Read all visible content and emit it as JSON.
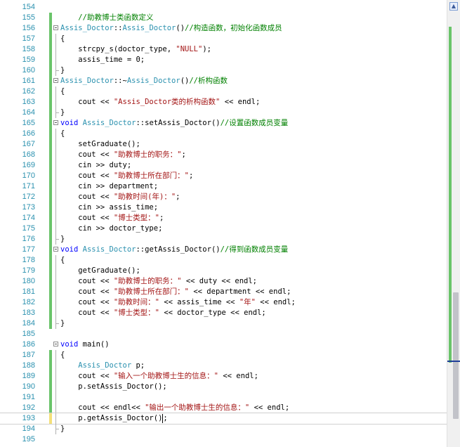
{
  "editor": {
    "lines": [
      {
        "n": "154",
        "t": ""
      },
      {
        "n": "155",
        "t": "    //助教博士类函数定义"
      },
      {
        "n": "156",
        "t": "Assis_Doctor::Assis_Doctor()//构造函数，初始化函数成员"
      },
      {
        "n": "157",
        "t": "{"
      },
      {
        "n": "158",
        "t": "    strcpy_s(doctor_type, \"NULL\");"
      },
      {
        "n": "159",
        "t": "    assis_time = 0;"
      },
      {
        "n": "160",
        "t": "}"
      },
      {
        "n": "161",
        "t": "Assis_Doctor::~Assis_Doctor()//析构函数"
      },
      {
        "n": "162",
        "t": "{"
      },
      {
        "n": "163",
        "t": "    cout << \"Assis_Doctor类的析构函数\" << endl;"
      },
      {
        "n": "164",
        "t": "}"
      },
      {
        "n": "165",
        "t": "void Assis_Doctor::setAssis_Doctor()//设置函数成员变量"
      },
      {
        "n": "166",
        "t": "{"
      },
      {
        "n": "167",
        "t": "    setGraduate();"
      },
      {
        "n": "168",
        "t": "    cout << \"助教博士的职务：\";"
      },
      {
        "n": "169",
        "t": "    cin >> duty;"
      },
      {
        "n": "170",
        "t": "    cout << \"助教博士所在部门：\";"
      },
      {
        "n": "171",
        "t": "    cin >> department;"
      },
      {
        "n": "172",
        "t": "    cout << \"助教时间(年)：\";"
      },
      {
        "n": "173",
        "t": "    cin >> assis_time;"
      },
      {
        "n": "174",
        "t": "    cout << \"博士类型：\";"
      },
      {
        "n": "175",
        "t": "    cin >> doctor_type;"
      },
      {
        "n": "176",
        "t": "}"
      },
      {
        "n": "177",
        "t": "void Assis_Doctor::getAssis_Doctor()//得到函数成员变量"
      },
      {
        "n": "178",
        "t": "{"
      },
      {
        "n": "179",
        "t": "    getGraduate();"
      },
      {
        "n": "180",
        "t": "    cout << \"助教博士的职务：\" << duty << endl;"
      },
      {
        "n": "181",
        "t": "    cout << \"助教博士所在部门：\" << department << endl;"
      },
      {
        "n": "182",
        "t": "    cout << \"助教时间：\" << assis_time << \"年\" << endl;"
      },
      {
        "n": "183",
        "t": "    cout << \"博士类型：\" << doctor_type << endl;"
      },
      {
        "n": "184",
        "t": "}"
      },
      {
        "n": "185",
        "t": ""
      },
      {
        "n": "186",
        "t": "void main()"
      },
      {
        "n": "187",
        "t": "{"
      },
      {
        "n": "188",
        "t": "    Assis_Doctor p;"
      },
      {
        "n": "189",
        "t": "    cout << \"输入一个助教博士生的信息：\" << endl;"
      },
      {
        "n": "190",
        "t": "    p.setAssis_Doctor();"
      },
      {
        "n": "191",
        "t": ""
      },
      {
        "n": "192",
        "t": "    cout << endl<< \"输出一个助教博士生的信息：\" << endl;"
      },
      {
        "n": "193",
        "t": "    p.getAssis_Doctor();"
      },
      {
        "n": "194",
        "t": "}"
      },
      {
        "n": "195",
        "t": ""
      }
    ]
  },
  "colors": {
    "keyword": "#0000ff",
    "type": "#2b91af",
    "string": "#a31515",
    "comment": "#008000",
    "line_number": "#2b91af",
    "change_saved": "#6ac46a",
    "change_unsaved": "#f4e07a"
  },
  "scrollbar": {
    "up_arrow_icon": "triangle-up"
  }
}
